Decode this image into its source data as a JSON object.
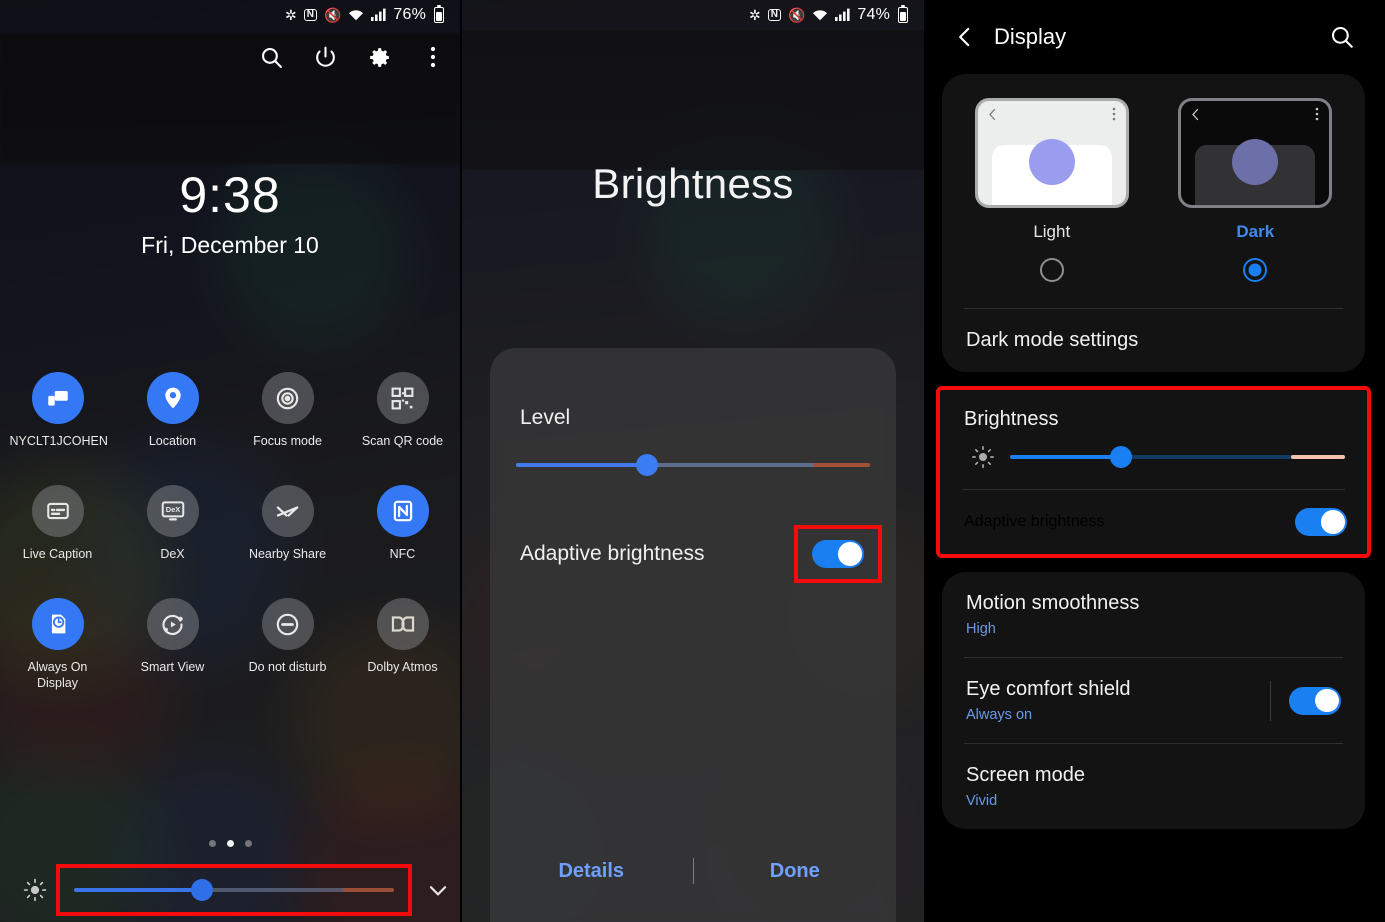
{
  "panel1": {
    "statusbar": {
      "icons": [
        "bluetooth-icon",
        "nfc-icon",
        "mute-icon",
        "wifi-icon",
        "signal-icon"
      ],
      "battery_percent": "76%"
    },
    "tools": [
      {
        "name": "search-icon",
        "label": "Search"
      },
      {
        "name": "power-icon",
        "label": "Power"
      },
      {
        "name": "gear-icon",
        "label": "Settings"
      },
      {
        "name": "more-vert-icon",
        "label": "More options"
      }
    ],
    "clock": {
      "time": "9:38",
      "date": "Fri, December 10"
    },
    "tiles": [
      {
        "label": "NYCLT1JCOHEN",
        "icon": "devices-icon",
        "state": "on"
      },
      {
        "label": "Location",
        "icon": "location-pin-icon",
        "state": "on"
      },
      {
        "label": "Focus mode",
        "icon": "target-icon",
        "state": "off"
      },
      {
        "label": "Scan QR code",
        "icon": "qr-code-icon",
        "state": "off"
      },
      {
        "label": "Live Caption",
        "icon": "caption-icon",
        "state": "off"
      },
      {
        "label": "DeX",
        "icon": "dex-icon",
        "state": "off"
      },
      {
        "label": "Nearby Share",
        "icon": "nearby-share-icon",
        "state": "off"
      },
      {
        "label": "NFC",
        "icon": "nfc-icon",
        "state": "on"
      },
      {
        "label": "Always On Display",
        "icon": "clock-page-icon",
        "state": "on"
      },
      {
        "label": "Smart View",
        "icon": "smart-view-icon",
        "state": "off"
      },
      {
        "label": "Do not disturb",
        "icon": "do-not-disturb-icon",
        "state": "off"
      },
      {
        "label": "Dolby Atmos",
        "icon": "dolby-icon",
        "state": "off"
      }
    ],
    "page_dots": {
      "count": 3,
      "active_index": 1
    },
    "brightness_slider": {
      "value_percent": 40,
      "tail_start_percent": 84,
      "highlighted": true
    },
    "sun_icon": "brightness-icon",
    "expand_icon": "chevron-down-icon"
  },
  "panel2": {
    "statusbar": {
      "battery_percent": "74%"
    },
    "title": "Brightness",
    "level_label": "Level",
    "level_slider": {
      "value_percent": 37,
      "tail_start_percent": 84
    },
    "adaptive_label": "Adaptive brightness",
    "adaptive_state": "on",
    "adaptive_highlighted": true,
    "actions": {
      "details": "Details",
      "done": "Done"
    }
  },
  "panel3": {
    "header": {
      "title": "Display",
      "back_icon": "chevron-left-icon",
      "search_icon": "search-icon"
    },
    "themes": [
      {
        "label": "Light",
        "selected": false
      },
      {
        "label": "Dark",
        "selected": true
      }
    ],
    "dark_mode_settings": "Dark mode settings",
    "brightness": {
      "title": "Brightness",
      "slider": {
        "value_percent": 33,
        "tail_start_percent": 84
      },
      "sun_icon": "brightness-icon",
      "adaptive_label": "Adaptive brightness",
      "adaptive_state": "on",
      "highlighted": true
    },
    "settings_rows": [
      {
        "title": "Motion smoothness",
        "sub": "High",
        "toggle": null
      },
      {
        "title": "Eye comfort shield",
        "sub": "Always on",
        "toggle": "on"
      },
      {
        "title": "Screen mode",
        "sub": "Vivid",
        "toggle": null
      }
    ]
  },
  "colors": {
    "accent_blue": "#1a7ff0",
    "tile_on_blue": "#3478f6",
    "highlight_red": "#f40c0c",
    "link_blue": "#6a9ae8",
    "card_dark": "#131313",
    "slider_tail_pink": "#f3c0ae"
  }
}
